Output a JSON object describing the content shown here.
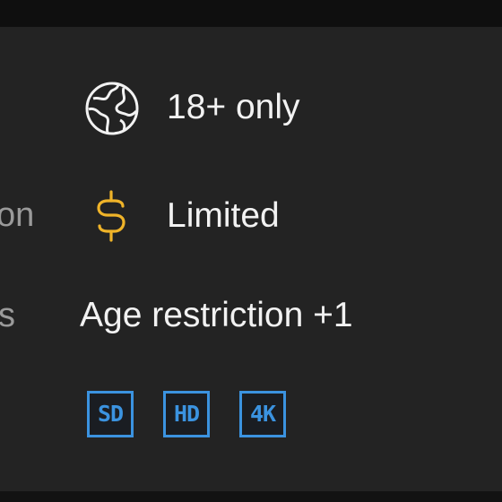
{
  "rows": {
    "region": {
      "label_fragment": "on",
      "value": "18+ only",
      "icon": "globe-icon"
    },
    "payment": {
      "label_fragment": "s",
      "value": "Limited",
      "icon": "dollar-icon",
      "icon_color": "#f0b429"
    },
    "age": {
      "value": "Age restriction +1"
    }
  },
  "quality_badges": [
    {
      "label": "SD"
    },
    {
      "label": "HD"
    },
    {
      "label": "4K"
    }
  ],
  "colors": {
    "badge_accent": "#3b93e0",
    "panel_bg": "#232323",
    "text": "#f2f2f2",
    "muted_text": "#9a9a9a"
  }
}
